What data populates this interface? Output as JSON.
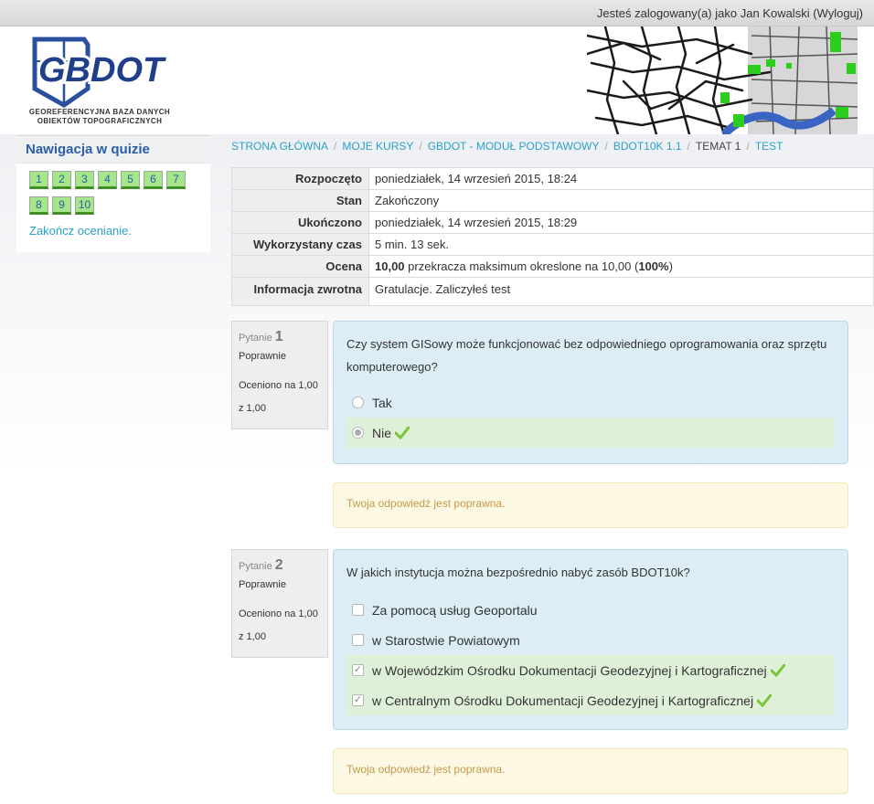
{
  "topbar": {
    "login_prefix": "Jesteś zalogowany(a) jako ",
    "user_name": "Jan Kowalski",
    "logout_label": "(Wyloguj)"
  },
  "logo": {
    "title": "GBDOT",
    "subtitle_line1": "GEOREFERENCYJNA BAZA DANYCH",
    "subtitle_line2": "OBIEKTÓW TOPOGRAFICZNYCH"
  },
  "quiz_nav": {
    "title": "Nawigacja w quizie",
    "buttons": [
      "1",
      "2",
      "3",
      "4",
      "5",
      "6",
      "7",
      "8",
      "9",
      "10"
    ],
    "finish_label": "Zakończ ocenianie."
  },
  "breadcrumb": {
    "items": [
      "STRONA GŁÓWNA",
      "MOJE KURSY",
      "GBDOT - MODUŁ PODSTAWOWY",
      "BDOT10K 1.1"
    ],
    "current": "TEMAT 1",
    "last": "TEST",
    "separator": "/"
  },
  "summary": {
    "rows": [
      {
        "label": "Rozpoczęto",
        "value": "poniedziałek, 14 wrzesień 2015, 18:24"
      },
      {
        "label": "Stan",
        "value": "Zakończony"
      },
      {
        "label": "Ukończono",
        "value": "poniedziałek, 14 wrzesień 2015, 18:29"
      },
      {
        "label": "Wykorzystany czas",
        "value": "5 min. 13 sek."
      }
    ],
    "grade_label": "Ocena",
    "grade_value": "10,00",
    "grade_mid": " przekracza maksimum okreslone na 10,00 (",
    "grade_pct": "100%",
    "grade_end": ")",
    "feedback_label": "Informacja zwrotna",
    "feedback_value": "Gratulacje. Zaliczyłeś test"
  },
  "questions": [
    {
      "prefix": "Pytanie ",
      "number": "1",
      "state": "Poprawnie",
      "grade_line1": "Oceniono na 1,00",
      "grade_line2": "z 1,00",
      "text": "Czy system GISowy może funkcjonować bez odpowiedniego oprogramowania oraz sprzętu komputerowego?",
      "answers": [
        {
          "label": "Tak",
          "checked": false,
          "correct": false
        },
        {
          "label": "Nie",
          "checked": true,
          "correct": true
        }
      ],
      "feedback": "Twoja odpowiedź jest poprawna."
    },
    {
      "prefix": "Pytanie ",
      "number": "2",
      "state": "Poprawnie",
      "grade_line1": "Oceniono na 1,00",
      "grade_line2": "z 1,00",
      "text": "W jakich instytucja można bezpośrednio nabyć zasób BDOT10k?",
      "answers": [
        {
          "label": "Za pomocą usług Geoportalu",
          "checked": false,
          "correct": false
        },
        {
          "label": "w Starostwie Powiatowym",
          "checked": false,
          "correct": false
        },
        {
          "label": "w Wojewódzkim Ośrodku Dokumentacji Geodezyjnej i Kartograficznej",
          "checked": true,
          "correct": true
        },
        {
          "label": "w Centralnym Ośrodku Dokumentacji Geodezyjnej i Kartograficznej",
          "checked": true,
          "correct": true
        }
      ],
      "feedback": "Twoja odpowiedź jest poprawna."
    }
  ],
  "colors": {
    "accent": "#2a5ea8",
    "link": "#2aa0c8",
    "correct_bg": "#dff0d8",
    "tick": "#7cc43a"
  }
}
